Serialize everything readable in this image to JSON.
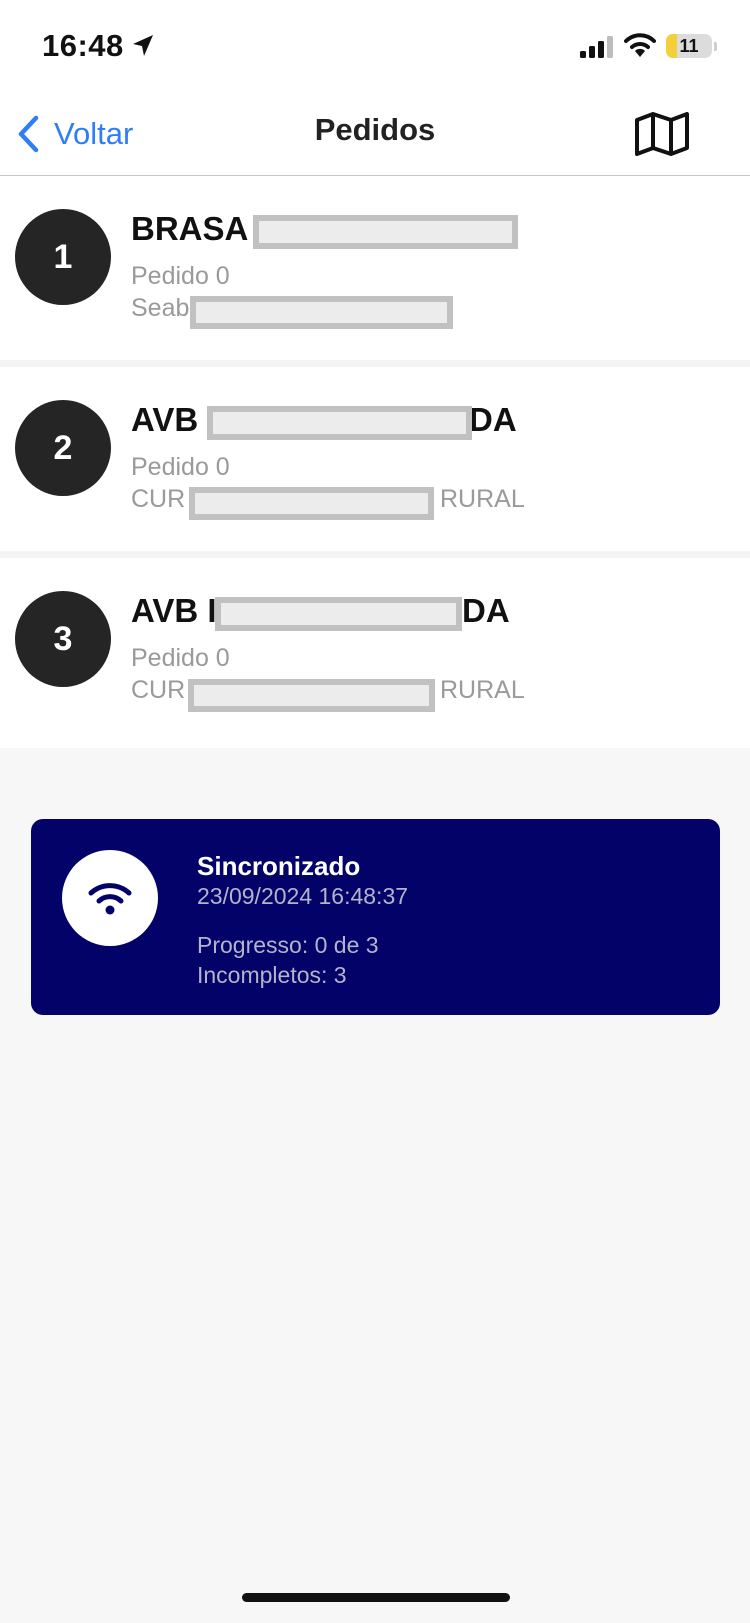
{
  "status_bar": {
    "time": "16:48",
    "battery": "11",
    "battery_level": 0.11
  },
  "nav": {
    "back_label": "Voltar",
    "title": "Pedidos",
    "map_icon": "map-icon"
  },
  "orders": [
    {
      "number": "1",
      "title_prefix": "BRASA",
      "title_suffix": "",
      "order_label": "Pedido 0",
      "address_prefix": "Seab",
      "address_suffix": ""
    },
    {
      "number": "2",
      "title_prefix": "AVB",
      "title_suffix": "DA",
      "order_label": "Pedido 0",
      "address_prefix": "CUR",
      "address_suffix": "RURAL"
    },
    {
      "number": "3",
      "title_prefix": "AVB I",
      "title_suffix": "DA",
      "order_label": "Pedido 0",
      "address_prefix": "CUR",
      "address_suffix": "RURAL"
    }
  ],
  "sync": {
    "icon": "wifi-icon",
    "title": "Sincronizado",
    "datetime": "23/09/2024 16:48:37",
    "progress": "Progresso: 0 de 3",
    "incomplete": "Incompletos: 3"
  },
  "colors": {
    "accent": "#2f7ef6",
    "badge": "#252525",
    "sync_card": "#020269",
    "secondary_text": "#9a9a9a"
  }
}
